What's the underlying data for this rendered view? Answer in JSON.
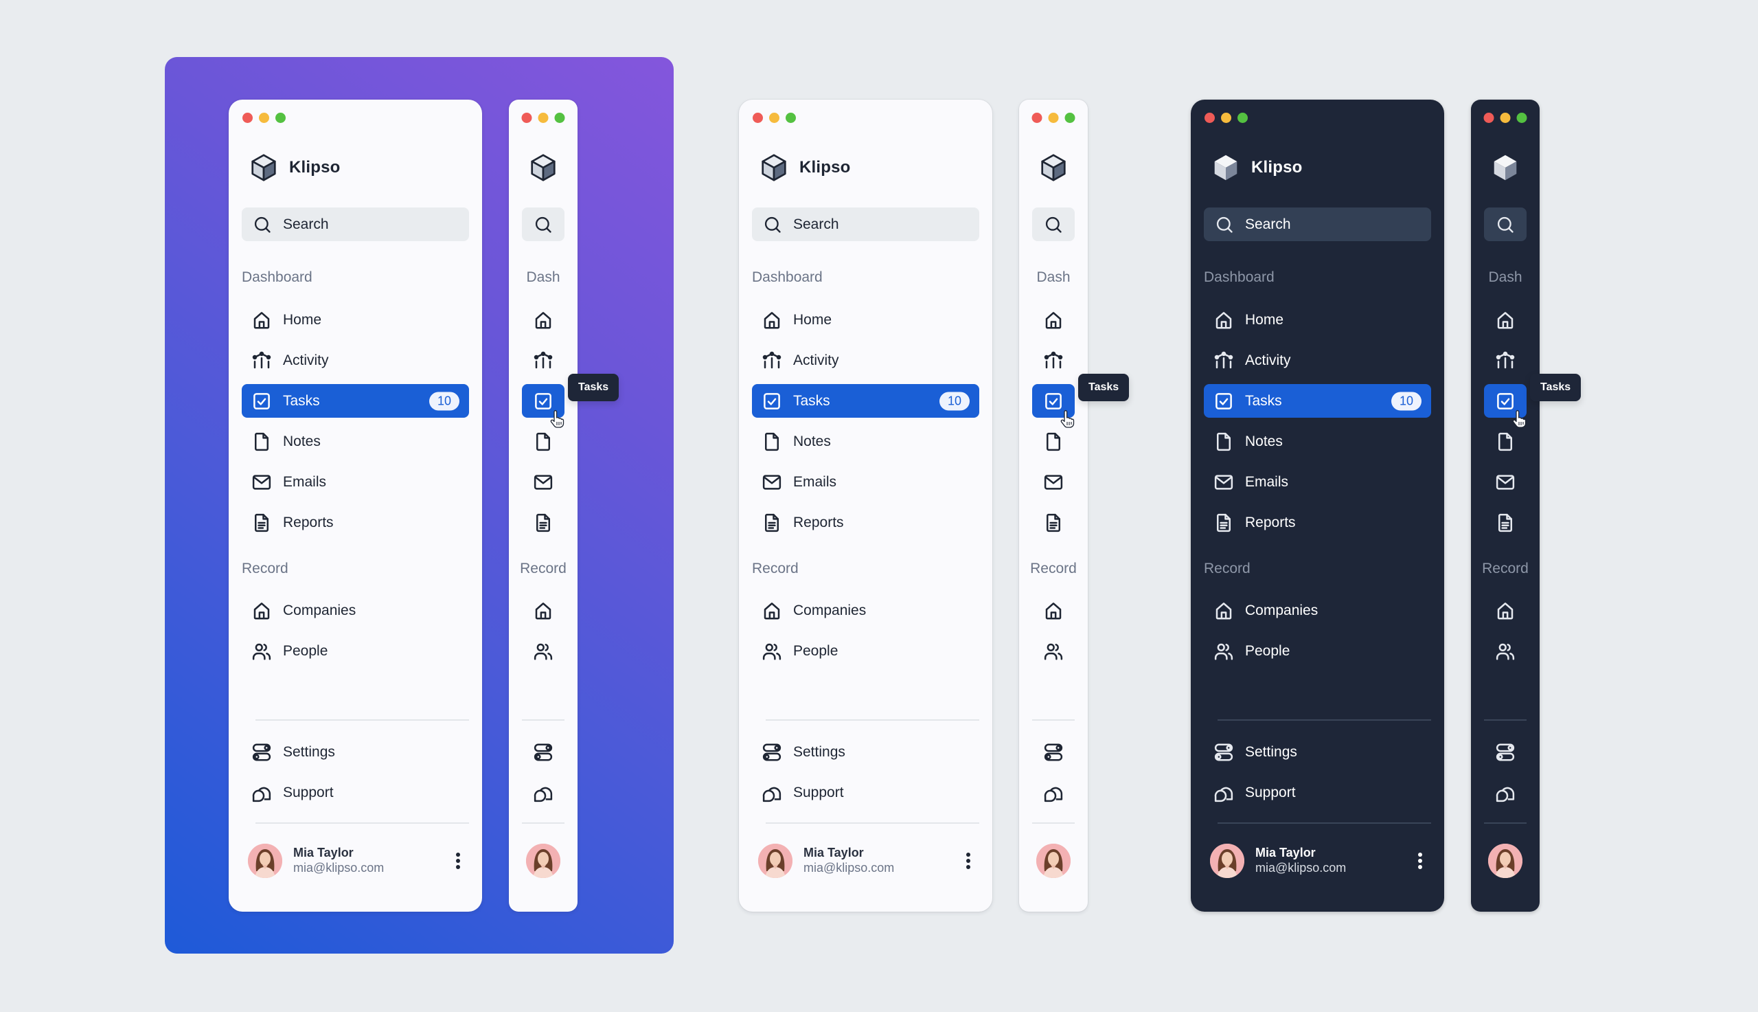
{
  "app": {
    "name": "Klipso",
    "search_label": "Search",
    "sections": {
      "dashboard_label": "Dashboard",
      "dashboard_short_label": "Dash",
      "record_label": "Record"
    },
    "dashboard_items": [
      {
        "label": "Home",
        "icon": "home-icon"
      },
      {
        "label": "Activity",
        "icon": "activity-icon"
      },
      {
        "label": "Tasks",
        "icon": "checkbox-icon",
        "badge": "10",
        "active": true
      },
      {
        "label": "Notes",
        "icon": "file-icon"
      },
      {
        "label": "Emails",
        "icon": "mail-icon"
      },
      {
        "label": "Reports",
        "icon": "report-icon"
      }
    ],
    "record_items": [
      {
        "label": "Companies",
        "icon": "building-icon"
      },
      {
        "label": "People",
        "icon": "users-icon"
      }
    ],
    "footer_items": [
      {
        "label": "Settings",
        "icon": "settings-toggle-icon"
      },
      {
        "label": "Support",
        "icon": "chat-bubbles-icon"
      }
    ],
    "user": {
      "name": "Mia Taylor",
      "email": "mia@klipso.com"
    },
    "tooltip_label": "Tasks"
  },
  "variants": [
    {
      "name": "light-on-gradient",
      "theme": "light"
    },
    {
      "name": "light",
      "theme": "light"
    },
    {
      "name": "dark",
      "theme": "dark"
    }
  ],
  "colors": {
    "accent": "#1a5fd6",
    "dark_bg": "#1e2638",
    "page_bg": "#e9ecef",
    "gradient_start": "#1e5ad8",
    "gradient_end": "#8456dc",
    "traffic_red": "#ef5b57",
    "traffic_yellow": "#f6bb3d",
    "traffic_green": "#54c141"
  }
}
